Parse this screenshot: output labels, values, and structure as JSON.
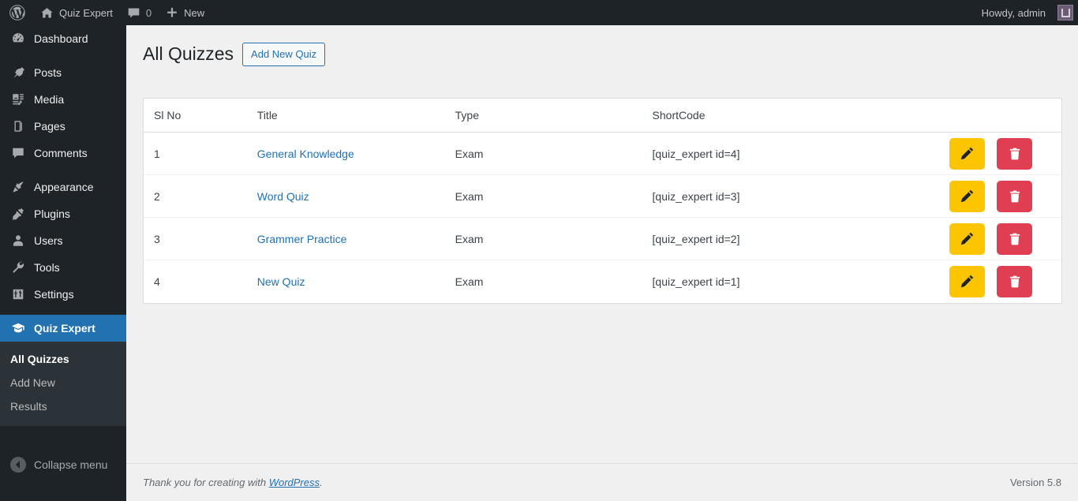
{
  "adminbar": {
    "wp_logo_label": "",
    "site_name": "Quiz Expert",
    "comments_count": "0",
    "new_label": "New",
    "howdy": "Howdy, admin"
  },
  "sidebar": {
    "items": [
      {
        "label": "Dashboard",
        "icon": "dashboard-icon",
        "current": false
      },
      {
        "label": "Posts",
        "icon": "posts-pin-icon",
        "current": false
      },
      {
        "label": "Media",
        "icon": "media-icon",
        "current": false
      },
      {
        "label": "Pages",
        "icon": "pages-icon",
        "current": false
      },
      {
        "label": "Comments",
        "icon": "comments-icon",
        "current": false
      },
      {
        "label": "Appearance",
        "icon": "appearance-brush-icon",
        "current": false
      },
      {
        "label": "Plugins",
        "icon": "plugins-plug-icon",
        "current": false
      },
      {
        "label": "Users",
        "icon": "users-icon",
        "current": false
      },
      {
        "label": "Tools",
        "icon": "tools-wrench-icon",
        "current": false
      },
      {
        "label": "Settings",
        "icon": "settings-sliders-icon",
        "current": false
      },
      {
        "label": "Quiz Expert",
        "icon": "graduation-cap-icon",
        "current": true
      }
    ],
    "submenu": [
      {
        "label": "All Quizzes",
        "current": true
      },
      {
        "label": "Add New",
        "current": false
      },
      {
        "label": "Results",
        "current": false
      }
    ],
    "collapse_label": "Collapse menu"
  },
  "page": {
    "title": "All Quizzes",
    "add_new_label": "Add New Quiz"
  },
  "table": {
    "columns": [
      "Sl No",
      "Title",
      "Type",
      "ShortCode",
      ""
    ],
    "rows": [
      {
        "sl": "1",
        "title": "General Knowledge",
        "type": "Exam",
        "shortcode": "[quiz_expert id=4]"
      },
      {
        "sl": "2",
        "title": "Word Quiz",
        "type": "Exam",
        "shortcode": "[quiz_expert id=3]"
      },
      {
        "sl": "3",
        "title": "Grammer Practice",
        "type": "Exam",
        "shortcode": "[quiz_expert id=2]"
      },
      {
        "sl": "4",
        "title": "New Quiz",
        "type": "Exam",
        "shortcode": "[quiz_expert id=1]"
      }
    ],
    "edit_icon": "pencil-icon",
    "delete_icon": "trash-icon"
  },
  "footer": {
    "thanks_prefix": "Thank you for creating with ",
    "wordpress_link": "WordPress",
    "thanks_suffix": ".",
    "version": "Version 5.8"
  },
  "colors": {
    "sidebar_bg": "#1d2327",
    "submenu_bg": "#2c3338",
    "accent_blue": "#2271b1",
    "content_bg": "#f0f0f1",
    "edit_yellow": "#fdc500",
    "delete_red": "#e03e52"
  }
}
